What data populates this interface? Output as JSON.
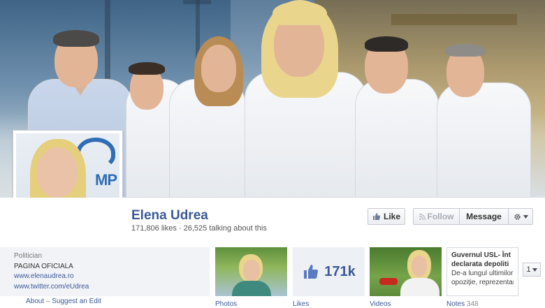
{
  "page": {
    "name": "Elena Udrea",
    "stats": "171,806 likes · 26,525 talking about this",
    "category": "Politician",
    "title": "PAGINA OFICIALA",
    "website": "www.elenaudrea.ro",
    "twitter": "www.twitter.com/eUdrea"
  },
  "profile_pic": {
    "logo_text": "MP"
  },
  "actions": {
    "like": "Like",
    "follow": "Follow",
    "message": "Message"
  },
  "footer_links": {
    "about": "About",
    "separator": "–",
    "suggest": "Suggest an Edit"
  },
  "tiles": {
    "photos": {
      "label": "Photos"
    },
    "likes": {
      "label": "Likes",
      "value": "171k"
    },
    "videos": {
      "label": "Videos"
    },
    "notes": {
      "label": "Notes",
      "count": "348",
      "title_line1": "Guvernul USL- Înt",
      "title_line2": "declarata depoliti",
      "body_line1": "De-a lungul ultimilor a",
      "body_line2": "opoziție, reprezentan"
    }
  },
  "pager": {
    "value": "1"
  },
  "colors": {
    "facebook_blue": "#3b5998",
    "cover_sky": "#5e7e9c",
    "cover_field": "#b49a62"
  },
  "icons": [
    "thumbs-up-icon",
    "follow-rss-icon",
    "gear-icon",
    "chevron-down-icon"
  ]
}
